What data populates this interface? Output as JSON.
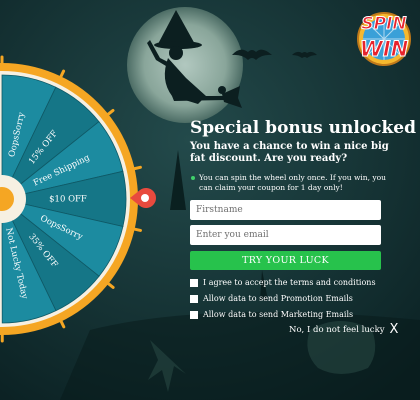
{
  "logo": {
    "line1": "SPIN",
    "line2": "WIN"
  },
  "wheel": {
    "segments": [
      "OopsSorry",
      "15% OFF",
      "Free Shipping",
      "$10 OFF",
      "OopsSorry",
      "35% OFF",
      "Not Lucky Today"
    ],
    "colors": [
      "#1c8ba0",
      "#157687"
    ]
  },
  "panel": {
    "title": "Special bonus unlocked",
    "subtitle": "You have a chance to win a nice big fat discount. Are you ready?",
    "note": "You can spin the wheel only once. If you win, you can claim your coupon for 1 day only!",
    "firstname_placeholder": "Firstname",
    "email_placeholder": "Enter you email",
    "cta_label": "TRY YOUR LUCK",
    "checkboxes": [
      "I agree to accept the terms and conditions",
      "Allow data to send Promotion Emails",
      "Allow data to send Marketing Emails"
    ]
  },
  "decline": {
    "label": "No, I do not feel lucky",
    "close": "X"
  },
  "colors": {
    "accent_green": "#27c24c",
    "pointer_red": "#e84a3e",
    "wheel_rim": "#f5a623"
  }
}
